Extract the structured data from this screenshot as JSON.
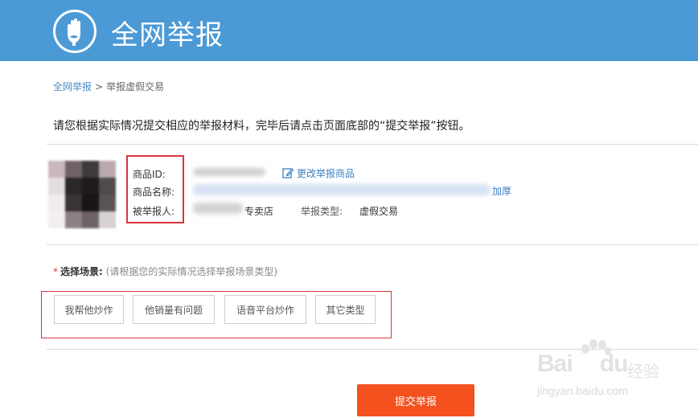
{
  "header": {
    "title": "全网举报",
    "logo_icon": "hand-in-circle-icon",
    "bg_color": "#4b9ad6"
  },
  "breadcrumb": {
    "home": "全网举报",
    "separator": ">",
    "current": "举报虚假交易"
  },
  "instruction": "请您根据实际情况提交相应的举报材料，完毕后请点击页面底部的“提交举报”按钮。",
  "product": {
    "id_label": "商品ID:",
    "name_label": "商品名称:",
    "reportee_label": "被举报人:",
    "edit_link": "更改举报商品",
    "reportee_suffix": "专卖店",
    "name_tail": "加厚",
    "type_label": "举报类型:",
    "type_value": "虚假交易"
  },
  "scene": {
    "required_mark": "*",
    "label": "选择场景:",
    "hint": "(请根据您的实际情况选择举报场景类型)",
    "options": [
      "我帮他炒作",
      "他销量有问题",
      "语音平台炒作",
      "其它类型"
    ]
  },
  "submit_label": "提交举报",
  "watermark": {
    "brand": "Bai",
    "brand_tail": "du",
    "cn": "经验",
    "url": "jingyan.baidu.com"
  },
  "colors": {
    "accent": "#f4511e",
    "link": "#4b8bc7",
    "highlight_box": "#d9353d"
  }
}
